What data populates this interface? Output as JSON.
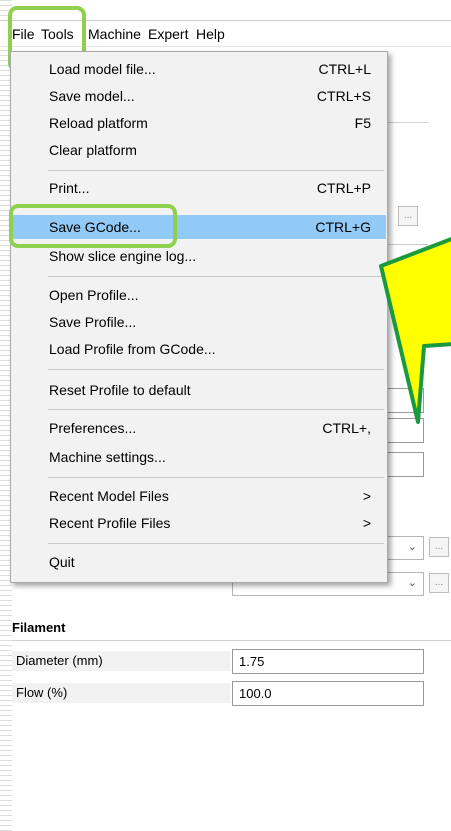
{
  "menubar": {
    "file": "File",
    "tools": "Tools",
    "machine": "Machine",
    "expert": "Expert",
    "help": "Help"
  },
  "file_menu": {
    "items": [
      {
        "label": "Load model file...",
        "shortcut": "CTRL+L"
      },
      {
        "label": "Save model...",
        "shortcut": "CTRL+S"
      },
      {
        "label": "Reload platform",
        "shortcut": "F5"
      },
      {
        "label": "Clear platform",
        "shortcut": ""
      },
      {
        "label": "Print...",
        "shortcut": "CTRL+P"
      },
      {
        "label": "Save GCode...",
        "shortcut": "CTRL+G"
      },
      {
        "label": "Show slice engine log...",
        "shortcut": ""
      },
      {
        "label": "Open Profile...",
        "shortcut": ""
      },
      {
        "label": "Save Profile...",
        "shortcut": ""
      },
      {
        "label": "Load Profile from GCode...",
        "shortcut": ""
      },
      {
        "label": "Reset Profile to default",
        "shortcut": ""
      },
      {
        "label": "Preferences...",
        "shortcut": "CTRL+,"
      },
      {
        "label": "Machine settings...",
        "shortcut": ""
      },
      {
        "label": "Recent Model Files",
        "shortcut": ">"
      },
      {
        "label": "Recent Profile Files",
        "shortcut": ">"
      },
      {
        "label": "Quit",
        "shortcut": ""
      }
    ],
    "highlighted_item": "Save GCode..."
  },
  "settings": {
    "ellipsis_button": "...",
    "partial_select_text": "e",
    "filament": {
      "title": "Filament",
      "rows": [
        {
          "label": "Diameter (mm)",
          "value": "1.75"
        },
        {
          "label": "Flow (%)",
          "value": "100.0"
        }
      ]
    }
  },
  "colors": {
    "highlight_green": "#8fd14f",
    "menu_selected": "#91c9f7",
    "callout_fill": "#ffff00",
    "callout_border": "#1a9a3c"
  }
}
